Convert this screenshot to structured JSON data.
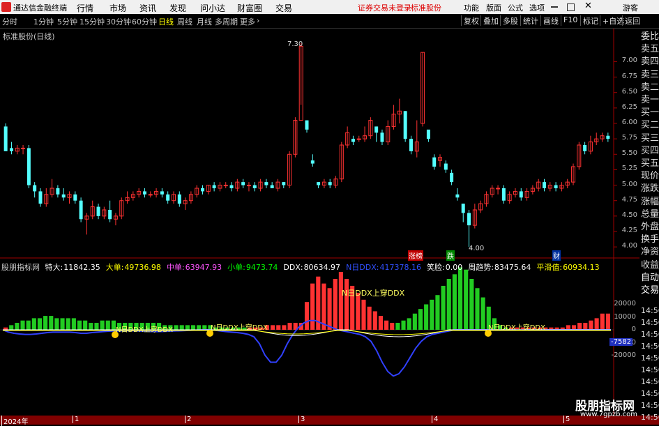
{
  "titlebar": {
    "app_name": "通达信金融终端",
    "menus": [
      "行情",
      "市场",
      "资讯",
      "发现",
      "问小达",
      "财富圈",
      "交易"
    ],
    "warning": "证券交易未登录",
    "stock_name": "标准股份",
    "right_items": [
      "功能",
      "版面",
      "公式",
      "选项"
    ],
    "user": "游客"
  },
  "toolbar": {
    "periods": [
      "分时",
      "1分钟",
      "5分钟",
      "15分钟",
      "30分钟",
      "60分钟",
      "日线",
      "周线",
      "月线",
      "多周期",
      "更多"
    ],
    "active_period": "日线",
    "right_buttons": [
      "复权",
      "叠加",
      "多股",
      "统计",
      "画线",
      "F10",
      "标记",
      "+自选",
      "返回"
    ]
  },
  "chart": {
    "title": "标准股份(日线)",
    "price_ticks": [
      "7.00",
      "6.75",
      "6.50",
      "6.25",
      "6.00",
      "5.75",
      "5.50",
      "5.25",
      "5.00",
      "4.75",
      "4.50",
      "4.25",
      "4.00"
    ],
    "high_label": "7.30",
    "low_label": "4.00",
    "markers": [
      "涨榜",
      "跌",
      "财"
    ],
    "colors": {
      "up": "#ff3232",
      "down": "#54ffff",
      "ma_blue": "#3040ff",
      "ma_white": "#ffffff",
      "ma_yellow": "#ffff00"
    }
  },
  "indicator": {
    "name": "股朋指标网",
    "items": [
      {
        "label": "特大:",
        "value": "11842.35",
        "color": "#ffffff"
      },
      {
        "label": "大单:",
        "value": "49736.98",
        "color": "#ffff00"
      },
      {
        "label": "中单:",
        "value": "63947.93",
        "color": "#ff55ff"
      },
      {
        "label": "小单:",
        "value": "9473.74",
        "color": "#00ff00"
      },
      {
        "label": "DDX:",
        "value": "80634.97",
        "color": "#ffffff"
      },
      {
        "label": "N日DDX:",
        "value": "417378.16",
        "color": "#3050ff"
      },
      {
        "label": "笑脸:",
        "value": "0.00",
        "color": "#ffffff"
      },
      {
        "label": "周趋势:",
        "value": "83475.64",
        "color": "#ffffff"
      },
      {
        "label": "平滑值:",
        "value": "60934.13",
        "color": "#ffff00"
      }
    ],
    "annotation": "N日DDX上穿DDX",
    "axis_ticks": [
      "20000",
      "10000",
      "0",
      "-10000",
      "-20000"
    ],
    "current_value": "-7582"
  },
  "sidebar": {
    "items": [
      "委比",
      "卖五",
      "卖四",
      "卖三",
      "卖二",
      "卖一",
      "买一",
      "买二",
      "买三",
      "买四",
      "买五",
      "现价",
      "涨跌",
      "涨幅",
      "总量",
      "外盘",
      "换手",
      "净资",
      "收益",
      "自动",
      "交易"
    ],
    "times": [
      "14:56",
      "14:56",
      "14:56",
      "14:56",
      "14:56",
      "14:56",
      "14:56",
      "14:56",
      "14:56",
      "14:56"
    ]
  },
  "datebar": {
    "labels": [
      "2024年",
      "1",
      "2",
      "3",
      "4",
      "5"
    ]
  },
  "watermark": {
    "line1": "股朋指标网",
    "line2": "www.7gpzb.com"
  },
  "chart_data": {
    "type": "candlestick",
    "title": "标准股份(日线)",
    "ylim": [
      3.9,
      7.4
    ],
    "candles": [
      [
        5.95,
        5.55,
        5.6,
        6.0
      ],
      [
        5.6,
        5.55,
        5.5,
        5.7
      ],
      [
        5.55,
        5.6,
        5.5,
        5.65
      ],
      [
        5.6,
        5.6,
        5.5,
        5.65
      ],
      [
        5.6,
        5.0,
        4.95,
        5.65
      ],
      [
        5.0,
        4.9,
        4.8,
        5.05
      ],
      [
        4.9,
        4.7,
        4.65,
        4.95
      ],
      [
        4.7,
        4.85,
        4.65,
        4.95
      ],
      [
        4.85,
        4.95,
        4.8,
        5.1
      ],
      [
        4.95,
        4.85,
        4.8,
        5.0
      ],
      [
        4.85,
        4.8,
        4.75,
        4.95
      ],
      [
        4.8,
        4.85,
        4.7,
        4.9
      ],
      [
        4.85,
        4.75,
        4.7,
        4.9
      ],
      [
        4.75,
        4.45,
        4.4,
        4.8
      ],
      [
        4.45,
        4.5,
        4.2,
        4.55
      ],
      [
        4.5,
        4.65,
        4.45,
        4.75
      ],
      [
        4.65,
        4.5,
        4.45,
        4.7
      ],
      [
        4.5,
        4.6,
        4.45,
        4.65
      ],
      [
        4.6,
        4.45,
        4.4,
        4.75
      ],
      [
        4.45,
        4.5,
        4.35,
        4.55
      ],
      [
        4.5,
        4.75,
        4.45,
        4.8
      ],
      [
        4.75,
        4.8,
        4.7,
        4.9
      ],
      [
        4.8,
        4.85,
        4.75,
        4.9
      ],
      [
        4.85,
        4.9,
        4.8,
        4.95
      ],
      [
        4.9,
        4.85,
        4.8,
        4.95
      ],
      [
        4.85,
        4.85,
        4.8,
        4.9
      ],
      [
        4.85,
        4.9,
        4.8,
        4.95
      ],
      [
        4.9,
        4.85,
        4.8,
        4.95
      ],
      [
        4.85,
        4.75,
        4.7,
        4.9
      ],
      [
        4.75,
        4.85,
        4.7,
        4.9
      ],
      [
        4.85,
        4.7,
        4.65,
        4.9
      ],
      [
        4.7,
        4.75,
        4.6,
        4.8
      ],
      [
        4.75,
        4.85,
        4.7,
        4.9
      ],
      [
        4.85,
        4.95,
        4.8,
        5.0
      ],
      [
        4.95,
        4.9,
        4.85,
        5.0
      ],
      [
        4.9,
        5.0,
        4.85,
        5.0
      ],
      [
        5.0,
        4.95,
        4.9,
        5.05
      ],
      [
        4.95,
        5.0,
        4.9,
        5.05
      ],
      [
        5.0,
        5.0,
        4.95,
        5.05
      ],
      [
        5.0,
        4.95,
        4.9,
        5.05
      ],
      [
        4.95,
        5.05,
        4.9,
        5.1
      ],
      [
        5.05,
        5.0,
        4.95,
        5.1
      ],
      [
        5.0,
        5.0,
        4.9,
        5.05
      ],
      [
        5.0,
        4.95,
        4.9,
        5.05
      ],
      [
        4.95,
        5.05,
        4.9,
        5.1
      ],
      [
        5.05,
        5.0,
        4.95,
        5.1
      ],
      [
        5.0,
        4.95,
        4.95,
        5.05
      ],
      [
        4.95,
        5.05,
        4.9,
        5.1
      ],
      [
        5.05,
        5.0,
        4.95,
        5.05
      ],
      [
        5.0,
        5.5,
        4.95,
        5.55
      ],
      [
        5.5,
        6.05,
        5.45,
        6.1
      ],
      [
        6.05,
        7.25,
        6.3,
        7.3
      ],
      [
        6.05,
        5.9,
        5.85,
        6.05
      ],
      [
        5.4,
        5.35,
        5.3,
        5.5
      ],
      [
        5.05,
        5.0,
        4.95,
        5.05
      ],
      [
        5.0,
        5.05,
        4.95,
        5.1
      ],
      [
        5.05,
        5.0,
        4.95,
        5.1
      ],
      [
        5.0,
        5.1,
        4.95,
        5.15
      ],
      [
        5.1,
        5.65,
        5.05,
        5.7
      ],
      [
        5.65,
        5.85,
        5.6,
        5.95
      ],
      [
        5.75,
        5.7,
        5.65,
        5.8
      ],
      [
        5.75,
        5.75,
        5.7,
        5.8
      ],
      [
        5.75,
        5.8,
        5.7,
        5.95
      ],
      [
        5.8,
        6.05,
        5.75,
        6.1
      ],
      [
        5.95,
        5.85,
        5.7,
        5.95
      ],
      [
        5.85,
        5.7,
        5.65,
        5.9
      ],
      [
        5.7,
        5.95,
        5.65,
        6.05
      ],
      [
        5.95,
        6.15,
        5.9,
        6.3
      ],
      [
        6.15,
        6.2,
        6.0,
        6.4
      ],
      [
        6.2,
        5.75,
        5.7,
        6.2
      ],
      [
        5.75,
        5.55,
        5.5,
        5.8
      ],
      [
        5.55,
        5.7,
        5.45,
        6.05
      ],
      [
        6.0,
        7.15,
        5.95,
        7.15
      ],
      [
        5.9,
        5.75,
        5.7,
        5.85
      ],
      [
        5.45,
        5.3,
        5.25,
        5.5
      ],
      [
        5.4,
        5.45,
        5.3,
        5.5
      ],
      [
        5.35,
        5.25,
        5.2,
        5.4
      ],
      [
        5.2,
        5.05,
        5.0,
        5.25
      ],
      [
        4.85,
        4.8,
        4.75,
        4.95
      ],
      [
        4.7,
        4.55,
        4.4,
        4.7
      ],
      [
        4.55,
        4.35,
        4.0,
        4.6
      ],
      [
        4.35,
        4.6,
        4.3,
        4.7
      ],
      [
        4.6,
        4.7,
        4.55,
        4.75
      ],
      [
        4.7,
        4.85,
        4.65,
        4.9
      ],
      [
        4.85,
        4.95,
        4.8,
        5.0
      ],
      [
        4.95,
        4.95,
        4.85,
        5.0
      ],
      [
        4.95,
        4.75,
        4.7,
        5.0
      ],
      [
        4.75,
        4.85,
        4.7,
        4.9
      ],
      [
        4.85,
        4.9,
        4.8,
        4.95
      ],
      [
        4.9,
        4.8,
        4.75,
        4.95
      ],
      [
        4.8,
        4.9,
        4.75,
        4.95
      ],
      [
        4.9,
        4.95,
        4.85,
        5.0
      ],
      [
        4.95,
        5.05,
        4.9,
        5.1
      ],
      [
        5.05,
        4.95,
        4.9,
        5.1
      ],
      [
        4.95,
        5.0,
        4.9,
        5.05
      ],
      [
        5.0,
        4.95,
        4.9,
        5.05
      ],
      [
        4.95,
        5.0,
        4.9,
        5.05
      ],
      [
        5.0,
        5.05,
        4.95,
        5.1
      ],
      [
        5.05,
        5.3,
        5.0,
        5.35
      ],
      [
        5.3,
        5.65,
        5.25,
        5.7
      ],
      [
        5.65,
        5.55,
        5.5,
        5.7
      ],
      [
        5.55,
        5.7,
        5.5,
        5.8
      ],
      [
        5.7,
        5.75,
        5.65,
        5.85
      ],
      [
        5.75,
        5.8,
        5.7,
        5.85
      ],
      [
        5.8,
        5.75,
        5.7,
        5.85
      ]
    ],
    "indicator": {
      "bars": [
        -1,
        2,
        3,
        4,
        4,
        5,
        5,
        6,
        6,
        5,
        5,
        5,
        5,
        4,
        4,
        3,
        3,
        4,
        4,
        4,
        3,
        3,
        3,
        3,
        3,
        3,
        3,
        3,
        2,
        2,
        2,
        2,
        2,
        2,
        2,
        2,
        2,
        1,
        1,
        1,
        1,
        1,
        1,
        -1,
        -1,
        -1,
        -2,
        -2,
        -2,
        -2,
        -3,
        -3,
        -3,
        12,
        20,
        23,
        20,
        -18,
        -22,
        -25,
        -22,
        -19,
        -16,
        -13,
        -10,
        -8,
        -6,
        -4,
        -3,
        3,
        4,
        5,
        7,
        9,
        11,
        13,
        15,
        19,
        22,
        24,
        27,
        26,
        22,
        18,
        14,
        10,
        5,
        2,
        1,
        -1,
        -1,
        -1,
        -1,
        -1,
        -1,
        -1,
        -1,
        -1,
        -1,
        -2,
        -2,
        -3,
        -3,
        -4,
        -5,
        -7,
        -7
      ],
      "ylim": [
        -22000,
        22000
      ]
    }
  }
}
